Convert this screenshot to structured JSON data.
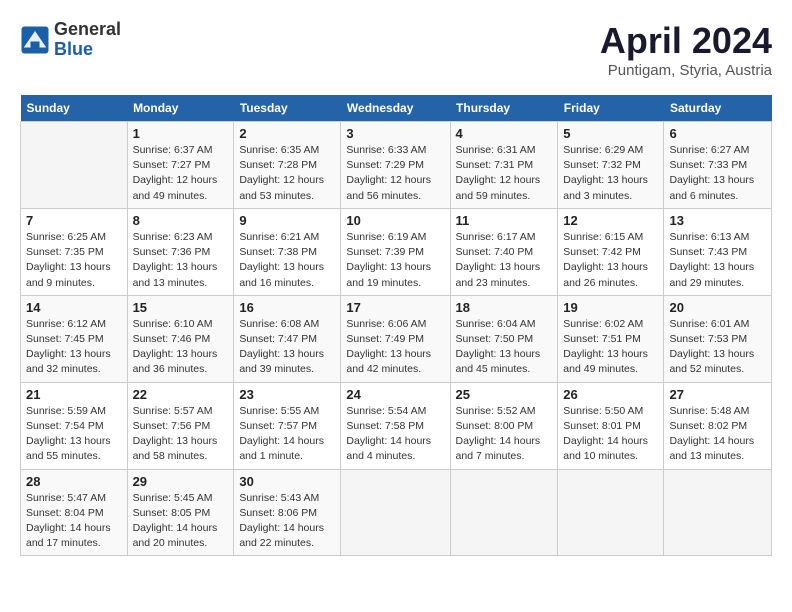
{
  "logo": {
    "general": "General",
    "blue": "Blue"
  },
  "header": {
    "title": "April 2024",
    "subtitle": "Puntigam, Styria, Austria"
  },
  "weekdays": [
    "Sunday",
    "Monday",
    "Tuesday",
    "Wednesday",
    "Thursday",
    "Friday",
    "Saturday"
  ],
  "weeks": [
    [
      {
        "day": "",
        "info": ""
      },
      {
        "day": "1",
        "info": "Sunrise: 6:37 AM\nSunset: 7:27 PM\nDaylight: 12 hours\nand 49 minutes."
      },
      {
        "day": "2",
        "info": "Sunrise: 6:35 AM\nSunset: 7:28 PM\nDaylight: 12 hours\nand 53 minutes."
      },
      {
        "day": "3",
        "info": "Sunrise: 6:33 AM\nSunset: 7:29 PM\nDaylight: 12 hours\nand 56 minutes."
      },
      {
        "day": "4",
        "info": "Sunrise: 6:31 AM\nSunset: 7:31 PM\nDaylight: 12 hours\nand 59 minutes."
      },
      {
        "day": "5",
        "info": "Sunrise: 6:29 AM\nSunset: 7:32 PM\nDaylight: 13 hours\nand 3 minutes."
      },
      {
        "day": "6",
        "info": "Sunrise: 6:27 AM\nSunset: 7:33 PM\nDaylight: 13 hours\nand 6 minutes."
      }
    ],
    [
      {
        "day": "7",
        "info": "Sunrise: 6:25 AM\nSunset: 7:35 PM\nDaylight: 13 hours\nand 9 minutes."
      },
      {
        "day": "8",
        "info": "Sunrise: 6:23 AM\nSunset: 7:36 PM\nDaylight: 13 hours\nand 13 minutes."
      },
      {
        "day": "9",
        "info": "Sunrise: 6:21 AM\nSunset: 7:38 PM\nDaylight: 13 hours\nand 16 minutes."
      },
      {
        "day": "10",
        "info": "Sunrise: 6:19 AM\nSunset: 7:39 PM\nDaylight: 13 hours\nand 19 minutes."
      },
      {
        "day": "11",
        "info": "Sunrise: 6:17 AM\nSunset: 7:40 PM\nDaylight: 13 hours\nand 23 minutes."
      },
      {
        "day": "12",
        "info": "Sunrise: 6:15 AM\nSunset: 7:42 PM\nDaylight: 13 hours\nand 26 minutes."
      },
      {
        "day": "13",
        "info": "Sunrise: 6:13 AM\nSunset: 7:43 PM\nDaylight: 13 hours\nand 29 minutes."
      }
    ],
    [
      {
        "day": "14",
        "info": "Sunrise: 6:12 AM\nSunset: 7:45 PM\nDaylight: 13 hours\nand 32 minutes."
      },
      {
        "day": "15",
        "info": "Sunrise: 6:10 AM\nSunset: 7:46 PM\nDaylight: 13 hours\nand 36 minutes."
      },
      {
        "day": "16",
        "info": "Sunrise: 6:08 AM\nSunset: 7:47 PM\nDaylight: 13 hours\nand 39 minutes."
      },
      {
        "day": "17",
        "info": "Sunrise: 6:06 AM\nSunset: 7:49 PM\nDaylight: 13 hours\nand 42 minutes."
      },
      {
        "day": "18",
        "info": "Sunrise: 6:04 AM\nSunset: 7:50 PM\nDaylight: 13 hours\nand 45 minutes."
      },
      {
        "day": "19",
        "info": "Sunrise: 6:02 AM\nSunset: 7:51 PM\nDaylight: 13 hours\nand 49 minutes."
      },
      {
        "day": "20",
        "info": "Sunrise: 6:01 AM\nSunset: 7:53 PM\nDaylight: 13 hours\nand 52 minutes."
      }
    ],
    [
      {
        "day": "21",
        "info": "Sunrise: 5:59 AM\nSunset: 7:54 PM\nDaylight: 13 hours\nand 55 minutes."
      },
      {
        "day": "22",
        "info": "Sunrise: 5:57 AM\nSunset: 7:56 PM\nDaylight: 13 hours\nand 58 minutes."
      },
      {
        "day": "23",
        "info": "Sunrise: 5:55 AM\nSunset: 7:57 PM\nDaylight: 14 hours\nand 1 minute."
      },
      {
        "day": "24",
        "info": "Sunrise: 5:54 AM\nSunset: 7:58 PM\nDaylight: 14 hours\nand 4 minutes."
      },
      {
        "day": "25",
        "info": "Sunrise: 5:52 AM\nSunset: 8:00 PM\nDaylight: 14 hours\nand 7 minutes."
      },
      {
        "day": "26",
        "info": "Sunrise: 5:50 AM\nSunset: 8:01 PM\nDaylight: 14 hours\nand 10 minutes."
      },
      {
        "day": "27",
        "info": "Sunrise: 5:48 AM\nSunset: 8:02 PM\nDaylight: 14 hours\nand 13 minutes."
      }
    ],
    [
      {
        "day": "28",
        "info": "Sunrise: 5:47 AM\nSunset: 8:04 PM\nDaylight: 14 hours\nand 17 minutes."
      },
      {
        "day": "29",
        "info": "Sunrise: 5:45 AM\nSunset: 8:05 PM\nDaylight: 14 hours\nand 20 minutes."
      },
      {
        "day": "30",
        "info": "Sunrise: 5:43 AM\nSunset: 8:06 PM\nDaylight: 14 hours\nand 22 minutes."
      },
      {
        "day": "",
        "info": ""
      },
      {
        "day": "",
        "info": ""
      },
      {
        "day": "",
        "info": ""
      },
      {
        "day": "",
        "info": ""
      }
    ]
  ]
}
